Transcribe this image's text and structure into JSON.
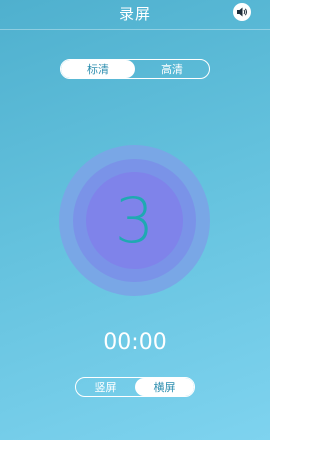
{
  "header": {
    "title": "录屏",
    "sound_icon": "speaker-icon"
  },
  "quality": {
    "options": [
      "标清",
      "高清"
    ],
    "selected": "标清"
  },
  "countdown": "3",
  "timer": "00:00",
  "orientation": {
    "options": [
      "竖屏",
      "横屏"
    ],
    "selected": "横屏"
  },
  "colors": {
    "background_top": "#4fb0ce",
    "background_bottom": "#7ed3ef",
    "dial_outer": "#79a7e6",
    "dial_mid": "#7a93e8",
    "dial_inner": "#7f83ea",
    "countdown_text": "#1fa9b2"
  }
}
